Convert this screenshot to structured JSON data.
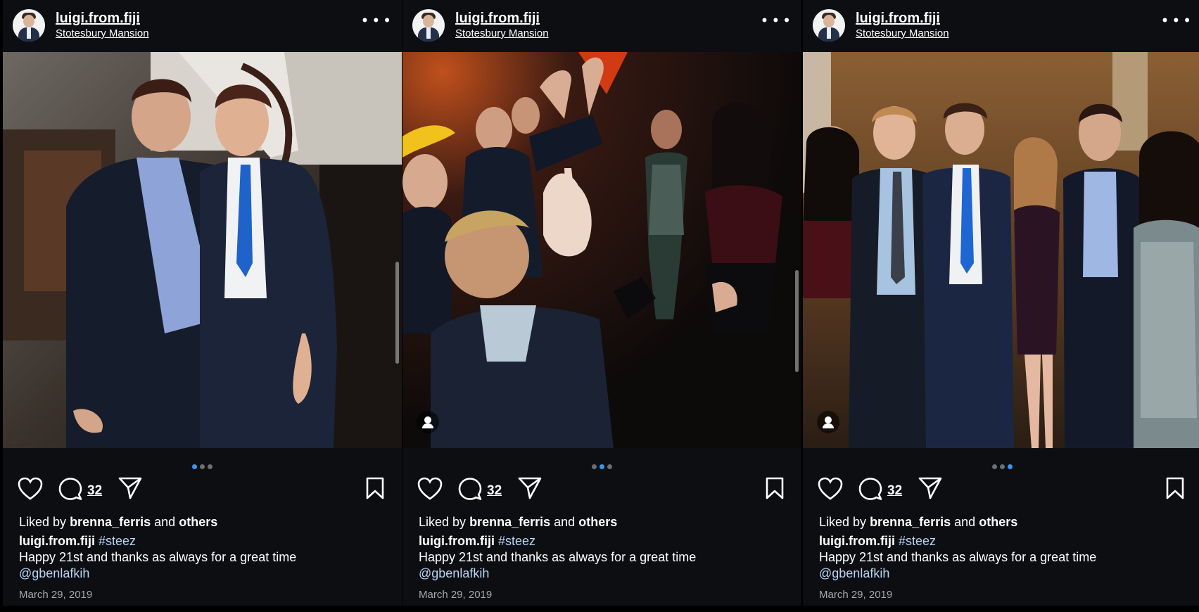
{
  "posts": [
    {
      "username": "luigi.from.fiji",
      "location": "Stotesbury Mansion",
      "comment_count": "32",
      "liked_prefix": "Liked by",
      "liked_user": "brenna_ferris",
      "liked_mid": "and",
      "liked_others": "others",
      "caption_user": "luigi.from.fiji",
      "caption_hashtag": "#steez",
      "caption_text": "Happy 21st and thanks as always for a great time",
      "caption_mention": "@gbenlafkih",
      "date": "March 29, 2019",
      "carousel_index": 1,
      "carousel_total": 3
    },
    {
      "username": "luigi.from.fiji",
      "location": "Stotesbury Mansion",
      "comment_count": "32",
      "liked_prefix": "Liked by",
      "liked_user": "brenna_ferris",
      "liked_mid": "and",
      "liked_others": "others",
      "caption_user": "luigi.from.fiji",
      "caption_hashtag": "#steez",
      "caption_text": "Happy 21st and thanks as always for a great time",
      "caption_mention": "@gbenlafkih",
      "date": "March 29, 2019",
      "carousel_index": 2,
      "carousel_total": 3
    },
    {
      "username": "luigi.from.fiji",
      "location": "Stotesbury Mansion",
      "comment_count": "32",
      "liked_prefix": "Liked by",
      "liked_user": "brenna_ferris",
      "liked_mid": "and",
      "liked_others": "others",
      "caption_user": "luigi.from.fiji",
      "caption_hashtag": "#steez",
      "caption_text": "Happy 21st and thanks as always for a great time",
      "caption_mention": "@gbenlafkih",
      "date": "March 29, 2019",
      "carousel_index": 3,
      "carousel_total": 3
    }
  ],
  "icons": {
    "more": "more-options-icon",
    "like": "heart-icon",
    "comment": "comment-bubble-icon",
    "share": "paper-plane-icon",
    "save": "bookmark-icon",
    "tag": "user-tag-icon"
  },
  "colors": {
    "background": "#0c0e12",
    "active_dot": "#3897f0",
    "link_text": "#b9d6f5",
    "date_text": "#a8a8a8"
  }
}
